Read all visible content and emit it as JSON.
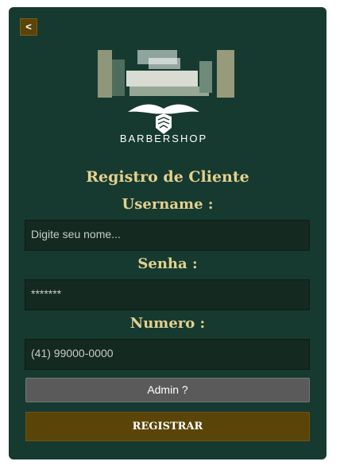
{
  "nav": {
    "back_label": "<"
  },
  "logo": {
    "icon": "barbershop-logo",
    "text": "BARBERSHOP"
  },
  "form": {
    "title": "Registro de Cliente",
    "username_label": "Username :",
    "username_placeholder": "Digite seu nome...",
    "password_label": "Senha :",
    "password_value": "*******",
    "number_label": "Numero :",
    "number_placeholder": "(41) 99000-0000",
    "admin_label": "Admin ?",
    "register_label": "REGISTRAR"
  },
  "colors": {
    "card": "#163a30",
    "accent_text": "#e4d18f",
    "register_button": "#5a4408",
    "admin_button": "#5a5a5a"
  }
}
